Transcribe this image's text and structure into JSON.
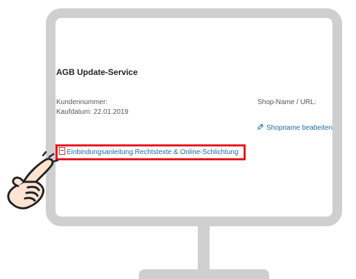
{
  "screen": {
    "title": "AGB Update-Service",
    "customer_number_label": "Kundennummer:",
    "purchase_date_label": "Kaufdatum: 22.01.2019",
    "shop_label": "Shop-Name / URL:",
    "edit_shop_link": "Shopname beabeiten",
    "guide_link": "Einbindungsanleitung Rechtstexte & Online-Schlichtung"
  },
  "icons": {
    "edit_icon": "edit-icon",
    "pdf_icon": "pdf-icon",
    "hand_icon": "pointing-hand-icon"
  },
  "colors": {
    "link": "#1d6aa5",
    "highlight_border": "#e8141b",
    "monitor": "#cfcfcf"
  }
}
